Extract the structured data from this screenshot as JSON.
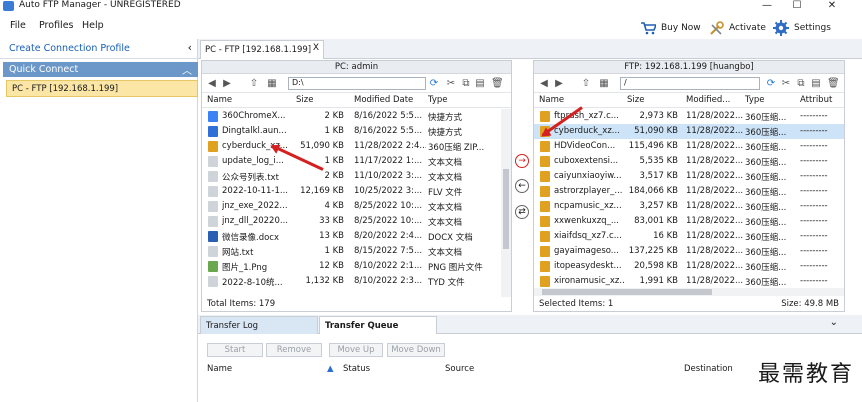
{
  "window": {
    "title": "Auto FTP Manager - UNREGISTERED",
    "minimize": "—",
    "maximize": "☐",
    "close": "✕"
  },
  "menu": {
    "file": "File",
    "profiles": "Profiles",
    "help": "Help"
  },
  "toolbar": {
    "buy_now": "Buy Now",
    "activate": "Activate",
    "settings": "Settings"
  },
  "sidebar": {
    "create_profile": "Create Connection Profile",
    "quick_connect": "Quick Connect",
    "item": "PC - FTP [192.168.1.199]"
  },
  "tab": {
    "label": "PC - FTP [192.168.1.199]",
    "close": "X"
  },
  "left_pane": {
    "header": "PC: admin",
    "path": "D:\\",
    "columns": [
      "Name",
      "Size",
      "Modified Date",
      "Type"
    ],
    "rows": [
      {
        "name": "360ChromeX...",
        "size": "2 KB",
        "date": "8/16/2022 5:5...",
        "type": "快捷方式",
        "icon": "#3b82f6"
      },
      {
        "name": "Dingtalkl.aun...",
        "size": "1 KB",
        "date": "8/16/2022 5:5...",
        "type": "快捷方式",
        "icon": "#2f6fd6"
      },
      {
        "name": "cyberduck_xz...",
        "size": "51,090 KB",
        "date": "11/28/2022 2:4...",
        "type": "360压缩 ZIP...",
        "icon": "#e0a020"
      },
      {
        "name": "update_log_i...",
        "size": "1 KB",
        "date": "11/17/2022 1:...",
        "type": "文本文档",
        "icon": "#cfd4da"
      },
      {
        "name": "公众号列表.txt",
        "size": "2 KB",
        "date": "11/10/2022 3:...",
        "type": "文本文档",
        "icon": "#cfd4da"
      },
      {
        "name": "2022-10-11-1...",
        "size": "12,169 KB",
        "date": "10/25/2022 3:...",
        "type": "FLV 文件",
        "icon": "#cfd4da"
      },
      {
        "name": "jnz_exe_2022...",
        "size": "4 KB",
        "date": "8/25/2022 10:...",
        "type": "文本文档",
        "icon": "#cfd4da"
      },
      {
        "name": "jnz_dll_20220...",
        "size": "33 KB",
        "date": "8/25/2022 10:...",
        "type": "文本文档",
        "icon": "#cfd4da"
      },
      {
        "name": "微信录像.docx",
        "size": "13 KB",
        "date": "8/20/2022 2:4...",
        "type": "DOCX 文档",
        "icon": "#2b5fb3"
      },
      {
        "name": "网站.txt",
        "size": "1 KB",
        "date": "8/15/2022 7:5...",
        "type": "文本文档",
        "icon": "#cfd4da"
      },
      {
        "name": "图片_1.Png",
        "size": "12 KB",
        "date": "8/10/2022 2:1...",
        "type": "PNG 图片文件",
        "icon": "#6aa84f"
      },
      {
        "name": "2022-8-10统...",
        "size": "1,132 KB",
        "date": "8/10/2022 2:3...",
        "type": "TYD 文件",
        "icon": "#cfd4da"
      }
    ],
    "status": "Total Items: 179"
  },
  "right_pane": {
    "header": "FTP: 192.168.1.199 [huangbo]",
    "path": "/",
    "columns": [
      "Name",
      "Size",
      "Modified...",
      "Type",
      "Attribut"
    ],
    "rows": [
      {
        "name": "ftprush_xz7.c...",
        "size": "2,973 KB",
        "date": "11/28/2022...",
        "type": "360压缩...",
        "attr": "---------"
      },
      {
        "name": "cyberduck_xz...",
        "size": "51,090 KB",
        "date": "11/28/2022...",
        "type": "360压缩...",
        "attr": "---------"
      },
      {
        "name": "HDVideoCon...",
        "size": "115,496 KB",
        "date": "11/28/2022...",
        "type": "360压缩...",
        "attr": "---------"
      },
      {
        "name": "cuboxextensi...",
        "size": "5,535 KB",
        "date": "11/28/2022...",
        "type": "360压缩...",
        "attr": "---------"
      },
      {
        "name": "caiyunxiaoyiw...",
        "size": "3,517 KB",
        "date": "11/28/2022...",
        "type": "360压缩...",
        "attr": "---------"
      },
      {
        "name": "astrorzplayer_...",
        "size": "184,066 KB",
        "date": "11/28/2022...",
        "type": "360压缩...",
        "attr": "---------"
      },
      {
        "name": "ncpamusic_xz...",
        "size": "3,257 KB",
        "date": "11/28/2022...",
        "type": "360压缩...",
        "attr": "---------"
      },
      {
        "name": "xxwenkuxzq_...",
        "size": "83,001 KB",
        "date": "11/28/2022...",
        "type": "360压缩...",
        "attr": "---------"
      },
      {
        "name": "xiaifdsq_xz7.c...",
        "size": "16 KB",
        "date": "11/28/2022...",
        "type": "360压缩...",
        "attr": "---------"
      },
      {
        "name": "gayaimageso...",
        "size": "137,225 KB",
        "date": "11/28/2022...",
        "type": "360压缩...",
        "attr": "---------"
      },
      {
        "name": "itopeasydeskt...",
        "size": "20,598 KB",
        "date": "11/28/2022...",
        "type": "360压缩...",
        "attr": "---------"
      },
      {
        "name": "xironamusic_xz...",
        "size": "1,991 KB",
        "date": "11/28/2022...",
        "type": "360压缩...",
        "attr": "---------"
      }
    ],
    "status_left": "Selected Items: 1",
    "status_right": "Size: 49.8 MB"
  },
  "transfer_tabs": {
    "log": "Transfer Log",
    "queue": "Transfer Queue"
  },
  "queue_buttons": {
    "start": "Start",
    "remove": "Remove",
    "move_up": "Move Up",
    "move_down": "Move Down"
  },
  "queue_columns": {
    "name": "Name",
    "status": "Status",
    "source": "Source",
    "destination": "Destination"
  },
  "watermark": "最需教育",
  "colors": {
    "accent": "#1a5fb4",
    "selection": "#cde3f7",
    "quick_connect": "#6b98c9",
    "highlight": "#fbe6a6",
    "arrow": "#d42020"
  }
}
